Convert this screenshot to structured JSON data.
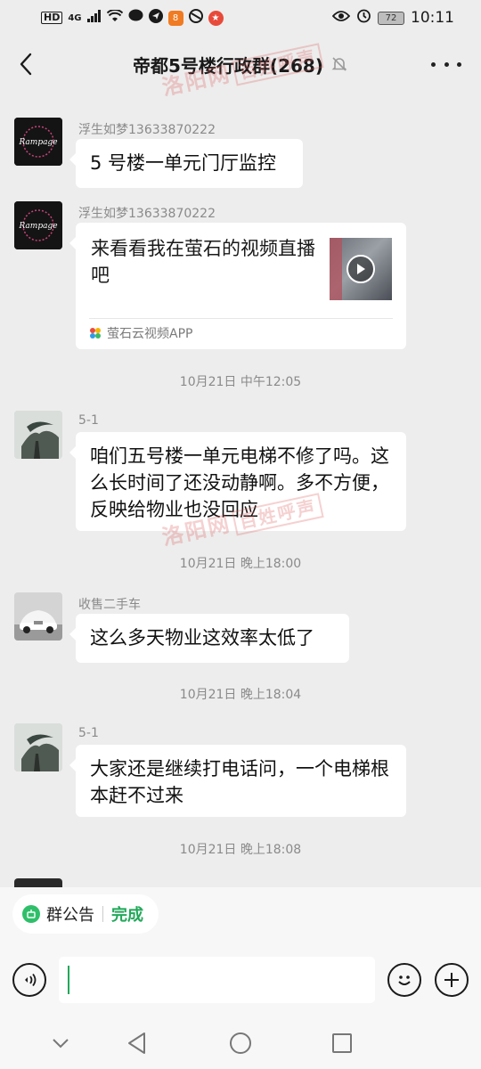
{
  "status_bar": {
    "left_hd": "HD",
    "left_network": "4G",
    "battery": "72",
    "time": "10:11"
  },
  "header": {
    "title": "帝都5号楼行政群(268)"
  },
  "watermark": {
    "site": "洛阳网",
    "tag": "百姓呼声"
  },
  "chat": {
    "messages": [
      {
        "sender": "浮生如梦13633870222",
        "text": "5 号楼一单元门厅监控",
        "avatar_text": "Rampage"
      },
      {
        "sender": "浮生如梦13633870222",
        "card_title": "来看看我在萤石的视频直播吧",
        "card_source": "萤石云视频APP",
        "avatar_text": "Rampage"
      },
      {
        "timestamp": "10月21日 中午12:05"
      },
      {
        "sender": "5-1",
        "text": "咱们五号楼一单元电梯不修了吗。这么长时间了还没动静啊。多不方便，反映给物业也没回应"
      },
      {
        "timestamp": "10月21日 晚上18:00"
      },
      {
        "sender": "收售二手车",
        "text": "这么多天物业这效率太低了"
      },
      {
        "timestamp": "10月21日 晚上18:04"
      },
      {
        "sender": "5-1",
        "text": "大家还是继续打电话问，一个电梯根本赶不过来"
      },
      {
        "timestamp": "10月21日 晚上18:08"
      }
    ]
  },
  "notice": {
    "label": "群公告",
    "done": "完成"
  },
  "colors": {
    "background": "#ededed",
    "bubble": "#ffffff",
    "accent_green": "#22a85a",
    "watermark_red": "#dc5a5a"
  }
}
